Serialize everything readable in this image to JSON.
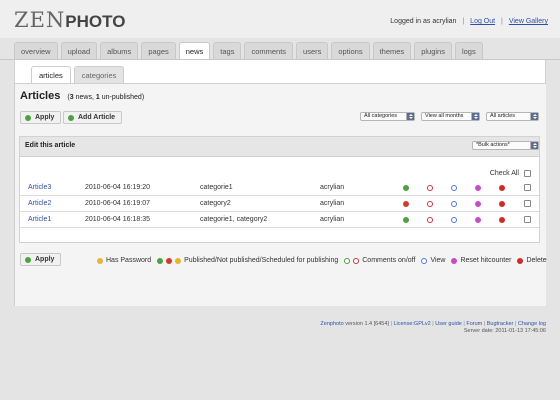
{
  "header": {
    "logo_zen": "ZEN",
    "logo_photo": "PHOTO",
    "logged_in": "Logged in as acrylian",
    "logout": "Log Out",
    "view_gallery": "View Gallery"
  },
  "tabs": [
    "overview",
    "upload",
    "albums",
    "pages",
    "news",
    "tags",
    "comments",
    "users",
    "options",
    "themes",
    "plugins",
    "logs"
  ],
  "active_tab": "news",
  "subtabs": [
    "articles",
    "categories"
  ],
  "page": {
    "title": "Articles",
    "summary_count_news": "3",
    "summary_news_word": "news,",
    "summary_count_unpub": "1",
    "summary_unpub_word": "un-published)",
    "apply": "Apply",
    "add_article": "Add Article",
    "filter_categories": "All categories",
    "filter_months": "View all months",
    "filter_articles": "All articles",
    "panel_title": "Edit this article",
    "bulk_actions": "*Bulk actions*",
    "check_all": "Check All"
  },
  "articles": [
    {
      "title": "Article3",
      "date": "2010-06-04 16:19:20",
      "categories": "categorie1",
      "author": "acrylian",
      "published": true
    },
    {
      "title": "Article2",
      "date": "2010-06-04 16:19:07",
      "categories": "category2",
      "author": "acrylian",
      "published": false
    },
    {
      "title": "Article1",
      "date": "2010-06-04 16:18:35",
      "categories": "categorie1, category2",
      "author": "acrylian",
      "published": true
    }
  ],
  "legend": {
    "password": "Has Password",
    "published": "Published/Not published/Scheduled for publishing",
    "comments": "Comments on/off",
    "view": "View",
    "reset": "Reset hitcounter",
    "delete": "Delete"
  },
  "footer": {
    "brand": "Zenphoto",
    "version": "version 1.4 [6454]",
    "license": "License:GPLv2",
    "user_guide": "User guide",
    "forum": "Forum",
    "bugtracker": "Bugtracker",
    "changelog": "Change log",
    "server_date": "Server date: 2011-01-13 17:45:06"
  },
  "colors": {
    "green": "#4aa33c",
    "red": "#d23a2a",
    "blue": "#4a7ad0",
    "magenta": "#c84bc8",
    "yellow": "#e5b52a"
  }
}
